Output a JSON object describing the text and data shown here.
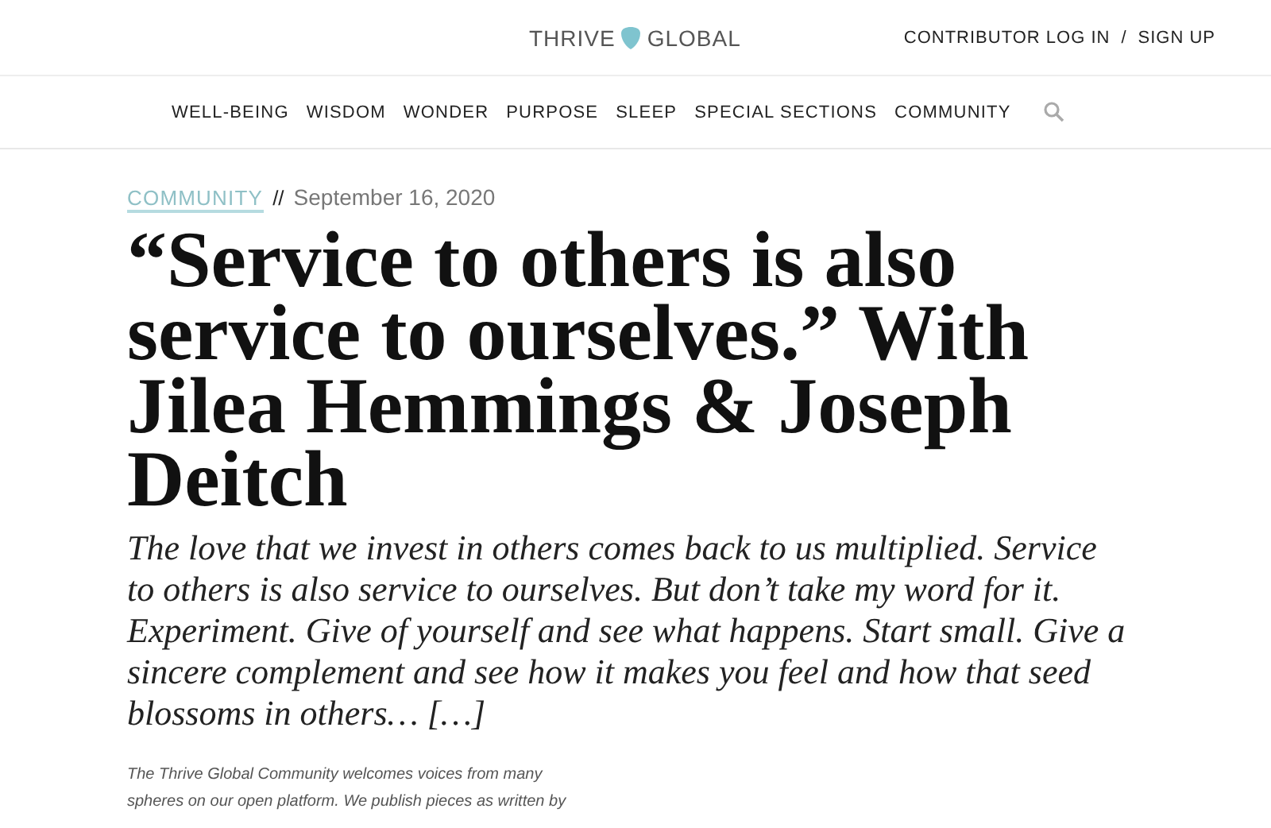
{
  "header": {
    "logo": {
      "left": "THRIVE",
      "right": "GLOBAL"
    },
    "links": [
      "CONTRIBUTOR LOG IN",
      "SIGN UP"
    ],
    "separator": "/"
  },
  "nav": {
    "items": [
      "WELL-BEING",
      "WISDOM",
      "WONDER",
      "PURPOSE",
      "SLEEP",
      "SPECIAL SECTIONS",
      "COMMUNITY"
    ]
  },
  "article": {
    "category": "COMMUNITY",
    "separator": "//",
    "date": "September 16, 2020",
    "title": "“Service to others is also service to ourselves.” With Jilea Hemmings & Joseph Deitch",
    "summary": "The love that we invest in others comes back to us multiplied. Service to others is also service to ourselves. But don’t take my word for it. Experiment. Give of yourself and see what happens. Start small. Give a sincere complement and see how it makes you feel and how that seed blossoms in others… […]",
    "notice": [
      "The Thrive Global Community welcomes voices from many",
      "spheres on our open platform. We publish pieces as written by"
    ]
  }
}
